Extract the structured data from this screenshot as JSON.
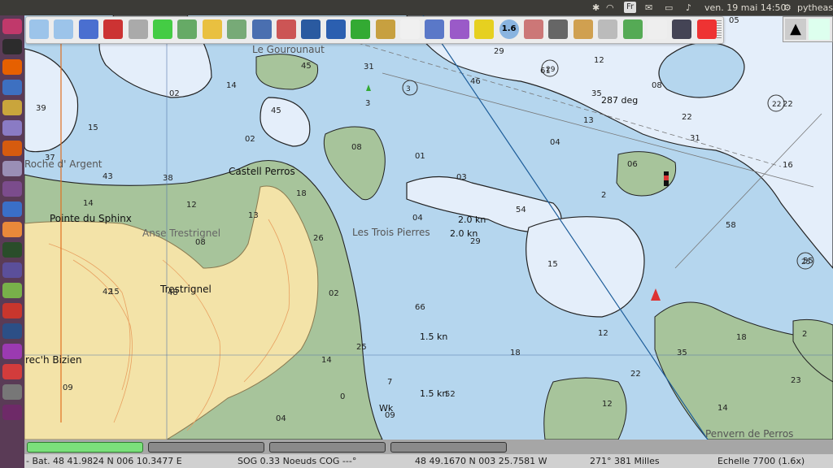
{
  "topbar": {
    "language": "Fr",
    "datetime": "ven. 19 mai 14:50",
    "user": "pytheas"
  },
  "launcher": {
    "apps": [
      "ubuntu-dash",
      "terminal",
      "firefox",
      "browser",
      "notes",
      "text-editor",
      "gimp",
      "app-g",
      "app-purple",
      "app-blue",
      "vlc",
      "monitor",
      "calendar",
      "app-green",
      "impress",
      "app-navy",
      "privacy",
      "app-red",
      "app-gray"
    ]
  },
  "toolbar": {
    "tools": [
      "zoom-in",
      "zoom-out",
      "route",
      "mob-boat",
      "settings",
      "ais-target",
      "tracks",
      "stretch",
      "rotate",
      "route-manager",
      "curve",
      "tide",
      "help",
      "save-download",
      "colors",
      "blank",
      "send",
      "waypoint-graph",
      "pencil",
      "scale",
      "waveform",
      "dog",
      "monitor-tool",
      "wind",
      "crosshair",
      "colors-palette",
      "globe",
      "lifebuoy"
    ],
    "scale_badge": "1.6"
  },
  "chart": {
    "places": [
      {
        "id": "le-gourounaut",
        "text": "Le Gourounaut"
      },
      {
        "id": "roche-d-argent",
        "text": "Roche d' Argent"
      },
      {
        "id": "castell-perros",
        "text": "Castell Perros"
      },
      {
        "id": "pointe-du-sphinx",
        "text": "Pointe du Sphinx"
      },
      {
        "id": "anse-trestrignel",
        "text": "Anse Trestrignel"
      },
      {
        "id": "les-trois-pierres",
        "text": "Les Trois Pierres"
      },
      {
        "id": "trestrignel",
        "text": "Trestrignel"
      },
      {
        "id": "crech-bizien",
        "text": "rec'h Bizien"
      },
      {
        "id": "penvern-perros",
        "text": "Penvern de Perros"
      }
    ],
    "labels": {
      "bearing": "287 deg",
      "tide1": "2.0 kn",
      "tide2": "2.0 kn",
      "tide3": "1.5 kn",
      "tide4": "1.5 kn",
      "wreck": "Wk"
    },
    "soundings": [
      "45",
      "31",
      "29",
      "12",
      "46",
      "05",
      "08",
      "3",
      "02",
      "14",
      "45",
      "39",
      "15",
      "35",
      "22",
      "13",
      "22",
      "03",
      "02",
      "08",
      "01",
      "04",
      "06",
      "31",
      "16",
      "37",
      "43",
      "38",
      "18",
      "12",
      "13",
      "04",
      "54",
      "2",
      "58",
      "14",
      "26",
      "08",
      "48",
      "15",
      "66",
      "55",
      "42",
      "02",
      "35",
      "18",
      "25",
      "14",
      "2",
      "7",
      "12",
      "22",
      "52",
      "18",
      "0",
      "12",
      "04",
      "14",
      "23",
      "09",
      "15",
      "29",
      "09",
      "61"
    ],
    "circled_depths": [
      "29",
      "3",
      "22",
      "25"
    ],
    "scale_readout": "1.6"
  },
  "piano": {
    "keys": [
      "key1",
      "key2",
      "key3",
      "key4"
    ],
    "active_index": 0
  },
  "status": {
    "position": "- Bat. 48 41.9824 N  006 10.3477 E",
    "sog": "SOG 0.33 Noeuds  COG ---°",
    "cursor": "48 49.1670 N  003 25.7581 W",
    "bearing_distance": "271°  381 Milles",
    "scale": "Echelle 7700 (1.6x)"
  },
  "colors": {
    "deep_water": "#b5d6ee",
    "shallow_water": "#e4eefa",
    "land": "#f3e3a8",
    "intertidal": "#a7c49b",
    "launcher_bg": "#5a3b56",
    "topbar_bg": "#3c3b37",
    "piano_active": "#7be07b"
  }
}
